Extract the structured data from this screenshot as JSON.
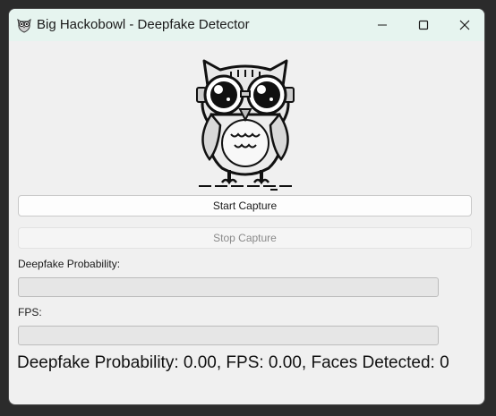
{
  "window": {
    "title": "Big Hackobowl - Deepfake Detector",
    "icon": "owl-icon"
  },
  "controls": {
    "start_label": "Start Capture",
    "stop_label": "Stop Capture",
    "stop_enabled": false
  },
  "metrics": {
    "probability_label": "Deepfake Probability:",
    "probability_value": 0.0,
    "fps_label": "FPS:",
    "fps_value": 0.0
  },
  "status_text": "Deepfake Probability: 0.00, FPS: 0.00, Faces Detected: 0"
}
